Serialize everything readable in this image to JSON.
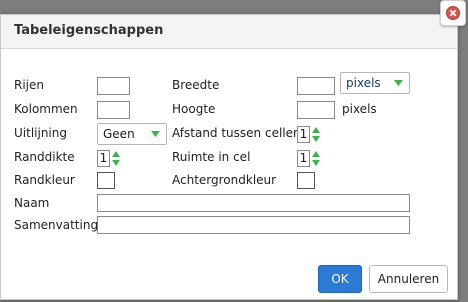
{
  "dialog": {
    "title": "Tabeleigenschappen",
    "close_icon": "close-icon"
  },
  "form": {
    "rows_label": "Rijen",
    "rows_value": "",
    "columns_label": "Kolommen",
    "columns_value": "",
    "align_label": "Uitlijning",
    "align_value": "Geen",
    "border_label": "Randdikte",
    "border_value": "1",
    "bordercolor_label": "Randkleur",
    "name_label": "Naam",
    "name_value": "",
    "summary_label": "Samenvatting",
    "summary_value": "",
    "width_label": "Breedte",
    "width_value": "",
    "width_unit": "pixels",
    "height_label": "Hoogte",
    "height_value": "",
    "height_unit": "pixels",
    "spacing_label": "Afstand tussen cellen",
    "spacing_value": "1",
    "padding_label": "Ruimte in cel",
    "padding_value": "1",
    "bgcolor_label": "Achtergrondkleur"
  },
  "buttons": {
    "ok": "OK",
    "cancel": "Annuleren"
  },
  "colors": {
    "accent": "#2a7ad6",
    "spinner_green": "#3bb24a",
    "titlebar": "#f4f4f4"
  }
}
